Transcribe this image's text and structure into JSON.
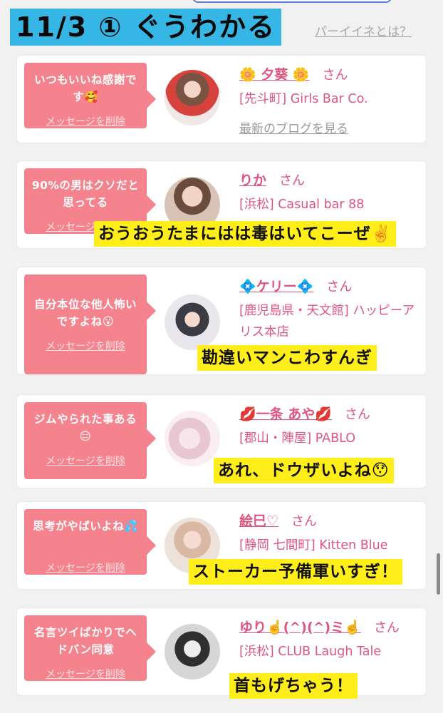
{
  "header": {
    "title": "11/3 ① ぐうわかる",
    "help_link": "パーイイネとは？"
  },
  "cards": [
    {
      "message": "いつもいいね感謝です🥰",
      "delete_label": "メッセージを削除",
      "cast_name": "🌼 夕葵 🌼",
      "san": "さん",
      "shop": "[先斗町] Girls Bar Co.",
      "blog_link": "最新のブログを見る",
      "caption": ""
    },
    {
      "message": "90%の男はクソだと思ってる",
      "delete_label": "メッセージを削除",
      "cast_name": "りか",
      "san": "さん",
      "shop": "[浜松] Casual bar 88",
      "blog_link": "",
      "caption": "おうおうたまにはは毒はいてこーぜ✌️"
    },
    {
      "message": "自分本位な他人怖いですよね😮",
      "delete_label": "メッセージを削除",
      "cast_name": "💠ケリー💠",
      "san": "さん",
      "shop": "[鹿児島県・天文館] ハッピーアリス本店",
      "blog_link": "",
      "caption": "勘違いマンこわすんぎ"
    },
    {
      "message": "ジムやられた事ある😑",
      "delete_label": "メッセージを削除",
      "cast_name": "💋一条 あや💋",
      "san": "さん",
      "shop": "[郡山・陣屋] PABLO",
      "blog_link": "",
      "caption": "あれ、ドウザいよね😯"
    },
    {
      "message": "思考がやばいよね💦",
      "delete_label": "メッセージを削除",
      "cast_name": "絵巳♡",
      "san": "さん",
      "shop": "[静岡 七間町] Kitten Blue",
      "blog_link": "",
      "caption": "ストーカー予備軍いすぎ！"
    },
    {
      "message": "名言ツイばかりでヘドバン同意",
      "delete_label": "メッセージを削除",
      "cast_name": "ゆり☝️(^)(^)ミ☝️",
      "san": "さん",
      "shop": "[浜松] CLUB Laugh Tale",
      "blog_link": "",
      "caption": "首もげちゃう！"
    }
  ]
}
